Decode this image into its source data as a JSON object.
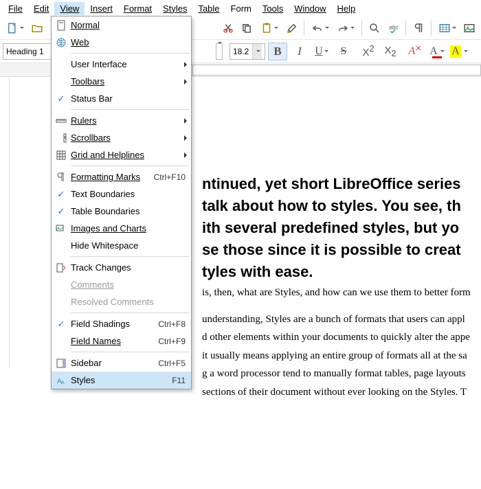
{
  "menubar": {
    "file": "File",
    "edit": "Edit",
    "view": "View",
    "insert": "Insert",
    "format": "Format",
    "styles": "Styles",
    "table": "Table",
    "form": "Form",
    "tools": "Tools",
    "window": "Window",
    "help": "Help"
  },
  "format_row": {
    "para_style": "Heading 1",
    "font_size": "18.2",
    "bold": "B",
    "italic": "I",
    "underline": "U",
    "strike": "S",
    "super": "X",
    "super_exp": "2",
    "sub": "X",
    "sub_exp": "2",
    "a_clear": "A",
    "a_color": "A",
    "a_hl": "A"
  },
  "view_menu": {
    "normal": "Normal",
    "web": "Web",
    "user_interface": "User Interface",
    "toolbars": "Toolbars",
    "status_bar": "Status Bar",
    "rulers": "Rulers",
    "scrollbars": "Scrollbars",
    "grid": "Grid and Helplines",
    "formatting_marks": "Formatting Marks",
    "formatting_marks_acc": "Ctrl+F10",
    "text_boundaries": "Text Boundaries",
    "table_boundaries": "Table Boundaries",
    "images_charts": "Images and Charts",
    "hide_whitespace": "Hide Whitespace",
    "track_changes": "Track Changes",
    "comments": "Comments",
    "resolved_comments": "Resolved Comments",
    "field_shadings": "Field Shadings",
    "field_shadings_acc": "Ctrl+F8",
    "field_names": "Field Names",
    "field_names_acc": "Ctrl+F9",
    "sidebar": "Sidebar",
    "sidebar_acc": "Ctrl+F5",
    "styles": "Styles",
    "styles_acc": "F11"
  },
  "doc": {
    "h1_l1": "ntinued, yet short LibreOffice series",
    "h1_l2": "talk about how to styles. You see, th",
    "h1_l3": "ith several predefined styles, but yo",
    "h1_l4": "se those since it is possible to creat",
    "h1_l5": "tyles with ease.",
    "p1": "is, then, what are Styles, and how can we use them to better form",
    "p2_l1": "understanding, Styles are a bunch of formats that users can appl",
    "p2_l2": "d other elements within your documents to quickly alter the appe",
    "p2_l3": "it usually means applying an entire group of formats all at the sa",
    "p2_l4": "g a word processor tend to manually format tables, page layouts",
    "p2_l5": "sections of their document without ever looking on the Styles. T"
  }
}
